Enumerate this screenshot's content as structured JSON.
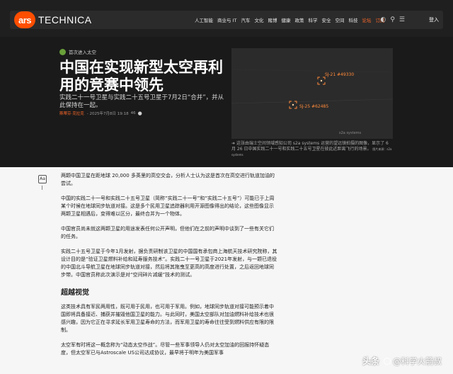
{
  "nav": {
    "logo_ars": "ars",
    "logo_technica": "TECHNICA",
    "menu": [
      {
        "label": "人工智能"
      },
      {
        "label": "商业与 IT"
      },
      {
        "label": "汽车"
      },
      {
        "label": "文化"
      },
      {
        "label": "赌博"
      },
      {
        "label": "健康"
      },
      {
        "label": "政策"
      },
      {
        "label": "科学"
      },
      {
        "label": "安全"
      },
      {
        "label": "空间"
      },
      {
        "label": "科技"
      },
      {
        "label": "论坛"
      },
      {
        "label": "订阅"
      }
    ],
    "icons": [
      "dark-mode-icon",
      "search-icon",
      "menu-icon"
    ],
    "login": "登入"
  },
  "hero": {
    "category": "首次进入太空",
    "title": "中国在实现新型太空再利用的竞赛中领先",
    "subtitle": "实践二十一号卫星与实践二十五号卫星于7月2日“合并”，并从此保持在一起。",
    "author": "斯蒂芬·克拉克",
    "date": "- 2025年7月8日 19:18",
    "comments": "46",
    "photo_labels": {
      "sat1": "SJ-21 #49330",
      "sat2": "SJ-25 #62485",
      "watermark": "s2a systems"
    },
    "caption": "这张由瑞士空间领域感知公司 s2a systems 运营的望远镜拍摄的图像，显示了 6 月 26 日中国实践二十一号和实践二十五号卫星在彼此近距离飞行的场景。",
    "caption_credit": "图片来源：s2a systems"
  },
  "article": {
    "p1": "两颗中国卫星在距地球 20,000 多英里的高空交会，分析人士认为这是首次在高空进行轨道加油的尝试。",
    "p2": "中国的实践二十一号和实践二十五号卫星（简称“实践二十一号”和“实践二十五号”）可能已于上周某个时候在地球同步轨道对接。这是多个民用卫星追踪器利用开源图像得出的结论，这些图像显示两颗卫星相遇后，变得难以区分，最终合并为一个物体。",
    "p3": "中国官员尚未就这两颗卫星的用途发表任何公开声明，但他们在之前的声明中谈到了一些有关它们的任务。",
    "p4": "实践二十五号卫星于今年1月发射，据负责研制该卫星的中国国有承包商上海航天技术研究院称，其设计目的是“验证卫星燃料补给和延寿服务技术”。实践二十一号卫星于2021年发射，与一颗已退役的中国北斗导航卫星在地球同步轨道对接，然后将其拖曳至更高的高度进行处置，之后返回地球同步带。中国官员称此次演示是对“空间碎片减缓”技术的测试。",
    "h2": "超越视觉",
    "p5": "这类技术具有军民两用性，既可用于民用，也可用于军用。例如，地球同步轨道对接可能预示着中国即将具备接近、捕获并摧毁他国卫星的能力。与此同时，美国太空部队对加油燃料补给技术也很感兴趣，因为它正在寻求延长军用卫星寿命的方法，而军用卫星的寿命往往受到燃料供应有限的限制。",
    "p6": "太空军有时将这一概念称为“动态太空作战”。尽管一些军事领导人仍对太空加油的回报持怀疑态度，但太空军已与Astroscale US公司达成协议，最早将于明年为美国军事"
  },
  "watermark": {
    "logo": "头条",
    "handle": "@科学火箭叔"
  },
  "colors": {
    "accent": "#ff4e00",
    "hero_bg": "#1a1a1a",
    "body_bg": "#f6f6f6",
    "highlight": "#ff6a2a"
  }
}
